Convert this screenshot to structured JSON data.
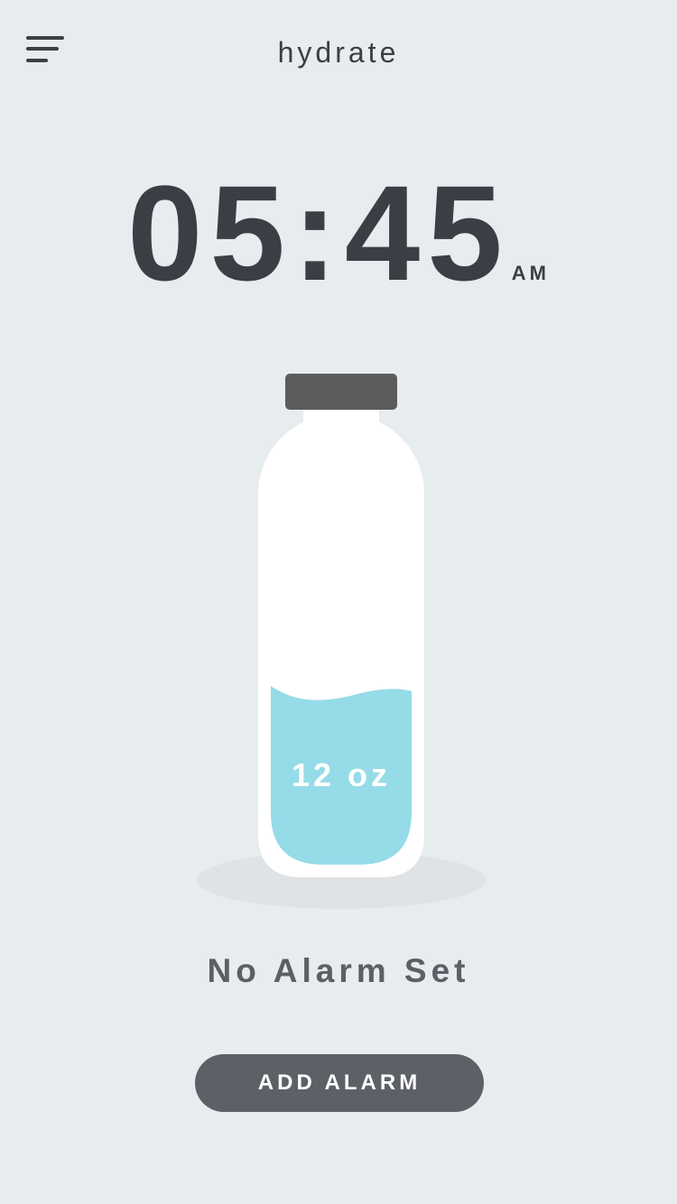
{
  "header": {
    "title": "hydrate",
    "menu_icon": "menu-icon"
  },
  "clock": {
    "time": "05:45",
    "ampm": "AM"
  },
  "bottle": {
    "water_amount": "12 oz",
    "fill_level": 0.42,
    "water_color": "#96dbe8",
    "cap_color": "#5c5c5c"
  },
  "alarm": {
    "status": "No Alarm Set",
    "add_button_label": "ADD ALARM"
  }
}
